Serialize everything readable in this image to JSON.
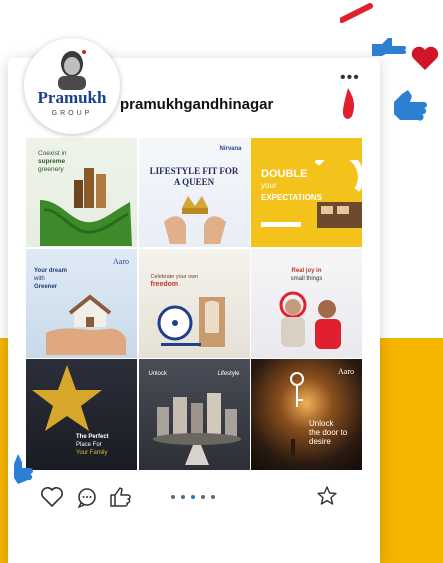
{
  "profile": {
    "logo_name": "Pramukh",
    "logo_sub": "GROUP",
    "username": "pramukhgandhinagar"
  },
  "posts": [
    {
      "id": "post-1",
      "line1": "Coexist in",
      "line2": "supreme",
      "line3": "greenery"
    },
    {
      "id": "post-2",
      "headline": "LIFESTYLE FIT FOR",
      "headline2": "A QUEEN",
      "brand": "Nirvana"
    },
    {
      "id": "post-3",
      "line1": "DOUBLE",
      "line2": "your",
      "line3": "EXPECTATIONS"
    },
    {
      "id": "post-4",
      "line1": "Your dream",
      "line2": "with",
      "line3": "Greener",
      "brand": "Aaro"
    },
    {
      "id": "post-5",
      "line1": "Celebrate your own",
      "line2": "freedom"
    },
    {
      "id": "post-6",
      "line1": "Real joy in",
      "line2": "small things"
    },
    {
      "id": "post-7",
      "line1": "The Perfect",
      "line2": "Place For",
      "line3": "Your Family"
    },
    {
      "id": "post-8",
      "line1": "Unlock",
      "brand": "Lifestyle"
    },
    {
      "id": "post-9",
      "line1": "Unlock",
      "line2": "the door to",
      "line3": "desire",
      "brand": "Aaro"
    }
  ],
  "carousel": {
    "count": 5,
    "active_index": 2
  },
  "colors": {
    "accent_yellow": "#f5b400",
    "brand_blue": "#1b3f8f",
    "like_red": "#e0202f",
    "thumb_blue": "#2d7fd3"
  }
}
